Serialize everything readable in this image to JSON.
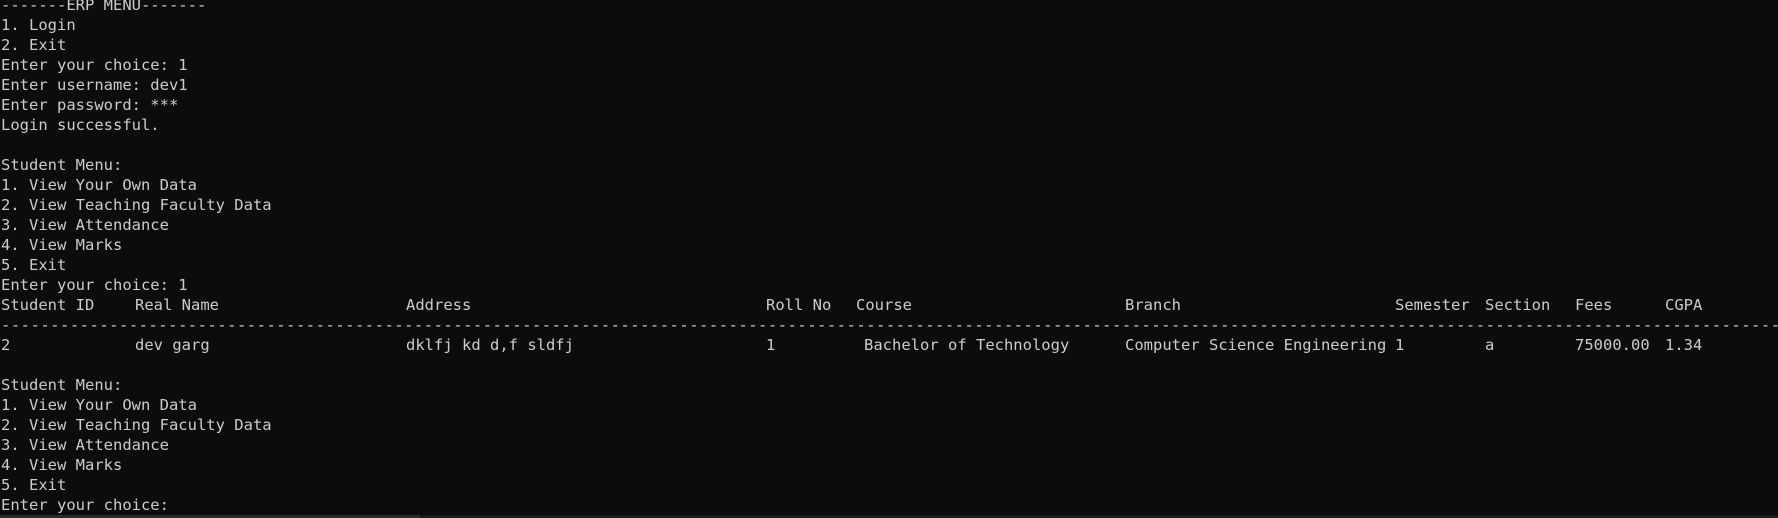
{
  "console": {
    "header_title": "-------ERP MENU-------",
    "main_menu": [
      "1. Login",
      "2. Exit"
    ],
    "prompt_choice_1": "Enter your choice: 1",
    "prompt_username": "Enter username: dev1",
    "prompt_password": "Enter password: ***",
    "login_status": "Login successful.",
    "student_menu_1": {
      "title": "Student Menu:",
      "items": [
        "1. View Your Own Data",
        "2. View Teaching Faculty Data",
        "3. View Attendance",
        "4. View Marks",
        "5. Exit"
      ],
      "choice": "Enter your choice: 1"
    },
    "table": {
      "headers": {
        "student_id": "Student ID",
        "real_name": "Real Name",
        "address": "Address",
        "roll_no": "Roll No",
        "course": "Course",
        "branch": "Branch",
        "semester": "Semester",
        "section": "Section",
        "fees": "Fees",
        "cgpa": "CGPA"
      },
      "divider": "---------------------------------------------------------------------------------------------------------------------------------------------------------------------------------------------------",
      "row": {
        "student_id": "2",
        "real_name": "dev garg",
        "address": "dklfj kd d,f sldfj",
        "roll_no": "1",
        "course": "Bachelor of Technology",
        "branch": "Computer Science Engineering",
        "semester": "1",
        "section": "a",
        "fees": "75000.00",
        "cgpa": "1.34"
      }
    },
    "student_menu_2": {
      "title": "Student Menu:",
      "items": [
        "1. View Your Own Data",
        "2. View Teaching Faculty Data",
        "3. View Attendance",
        "4. View Marks",
        "5. Exit"
      ],
      "choice": "Enter your choice:"
    }
  },
  "colors": {
    "background": "#0c0c0c",
    "text": "#cccccc"
  }
}
